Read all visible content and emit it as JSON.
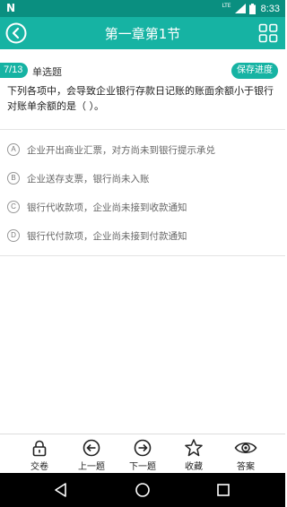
{
  "status_bar": {
    "network": "LTE",
    "time": "8:33",
    "icons": [
      "n-logo-icon",
      "wifi-icon",
      "signal-icon",
      "battery-icon"
    ]
  },
  "app_bar": {
    "title": "第一章第1节",
    "back_icon": "circle-back-icon",
    "grid_icon": "grid-icon",
    "color": "#16b3a3"
  },
  "question": {
    "progress": "7/13",
    "type": "单选题",
    "save_label": "保存进度",
    "text": "下列各项中，会导致企业银行存款日记账的账面余额小于银行对账单余额的是（   ）。",
    "options": [
      {
        "letter": "A",
        "text": "企业开出商业汇票，对方尚未到银行提示承兑"
      },
      {
        "letter": "B",
        "text": "企业送存支票，银行尚未入账"
      },
      {
        "letter": "C",
        "text": "银行代收款项，企业尚未接到收款通知"
      },
      {
        "letter": "D",
        "text": "银行代付款项，企业尚未接到付款通知"
      }
    ]
  },
  "bottom_tabs": [
    {
      "label": "交卷",
      "icon": "lock-icon"
    },
    {
      "label": "上一题",
      "icon": "arrow-left-circle-icon"
    },
    {
      "label": "下一题",
      "icon": "arrow-right-circle-icon"
    },
    {
      "label": "收藏",
      "icon": "star-icon"
    },
    {
      "label": "答案",
      "icon": "eye-icon"
    }
  ],
  "nav_bar": {
    "icons": [
      "back-triangle-icon",
      "home-circle-icon",
      "recents-square-icon"
    ]
  }
}
